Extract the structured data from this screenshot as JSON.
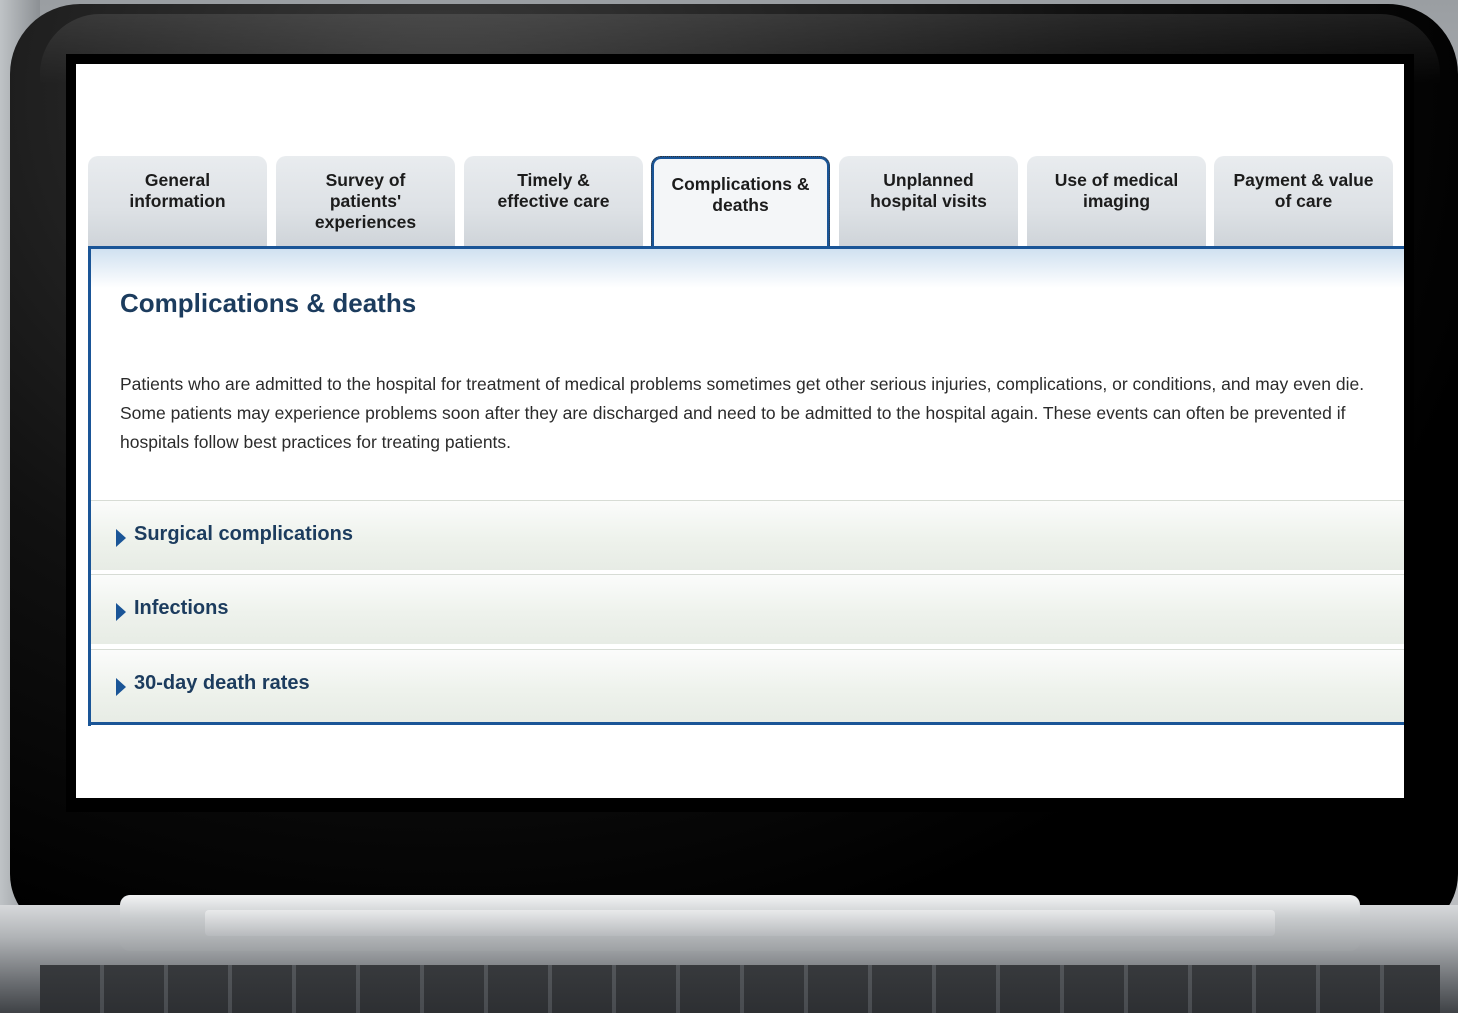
{
  "tabs": [
    {
      "label_lines": [
        "General",
        "information"
      ],
      "active": false
    },
    {
      "label_lines": [
        "Survey of",
        "patients'",
        "experiences"
      ],
      "active": false
    },
    {
      "label_lines": [
        "Timely &",
        "effective care"
      ],
      "active": false
    },
    {
      "label_lines": [
        "Complications &",
        "deaths"
      ],
      "active": true
    },
    {
      "label_lines": [
        "Unplanned",
        "hospital visits"
      ],
      "active": false
    },
    {
      "label_lines": [
        "Use of medical",
        "imaging"
      ],
      "active": false
    },
    {
      "label_lines": [
        "Payment & value",
        "of care"
      ],
      "active": false
    }
  ],
  "page": {
    "title": "Complications & deaths",
    "intro": "Patients who are admitted to the hospital for treatment of medical problems sometimes get other serious injuries, complications, or conditions, and may even die. Some patients may experience problems soon after they are discharged and need to be admitted to the hospital again. These events can often be prevented if hospitals follow best practices for treating patients."
  },
  "sections": [
    {
      "label": "Surgical complications",
      "icon": "expand-arrow-icon"
    },
    {
      "label": "Infections",
      "icon": "expand-arrow-icon"
    },
    {
      "label": "30-day death rates",
      "icon": "expand-arrow-icon"
    }
  ],
  "colors": {
    "accent": "#1a5597",
    "heading": "#1c3c5e",
    "tab_background": "#dde1e5",
    "section_background": "#eef2ec"
  }
}
